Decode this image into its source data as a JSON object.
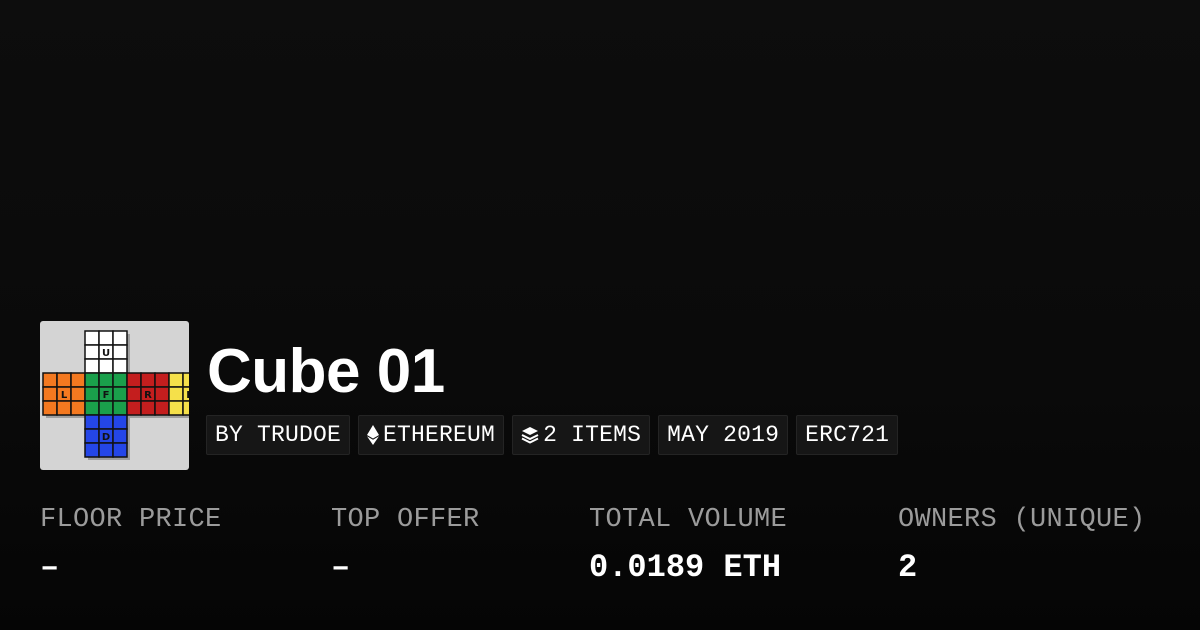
{
  "collection": {
    "name": "Cube 01",
    "thumbnail": {
      "icon": "rubiks-cube-net-icon",
      "face_letters": [
        "U",
        "L",
        "F",
        "R",
        "B",
        "D"
      ],
      "face_colors": {
        "U": "#ffffff",
        "L": "#f47920",
        "F": "#1aa04b",
        "R": "#c41e1e",
        "B": "#f5e04a",
        "D": "#2446e8"
      }
    }
  },
  "tags": [
    {
      "label": "BY TRUDOE",
      "icon": null
    },
    {
      "label": "ETHEREUM",
      "icon": "ethereum-icon"
    },
    {
      "label": "2 ITEMS",
      "icon": "layers-icon"
    },
    {
      "label": "MAY 2019",
      "icon": null
    },
    {
      "label": "ERC721",
      "icon": null
    }
  ],
  "stats": [
    {
      "label": "FLOOR PRICE",
      "value": "–"
    },
    {
      "label": "TOP OFFER",
      "value": "–"
    },
    {
      "label": "TOTAL VOLUME",
      "value": "0.0189 ETH"
    },
    {
      "label": "OWNERS (UNIQUE)",
      "value": "2"
    }
  ],
  "colors": {
    "background": "#0a0a0a",
    "tag_background": "#161616",
    "label_gray": "#9b9b9b",
    "text": "#ffffff"
  }
}
